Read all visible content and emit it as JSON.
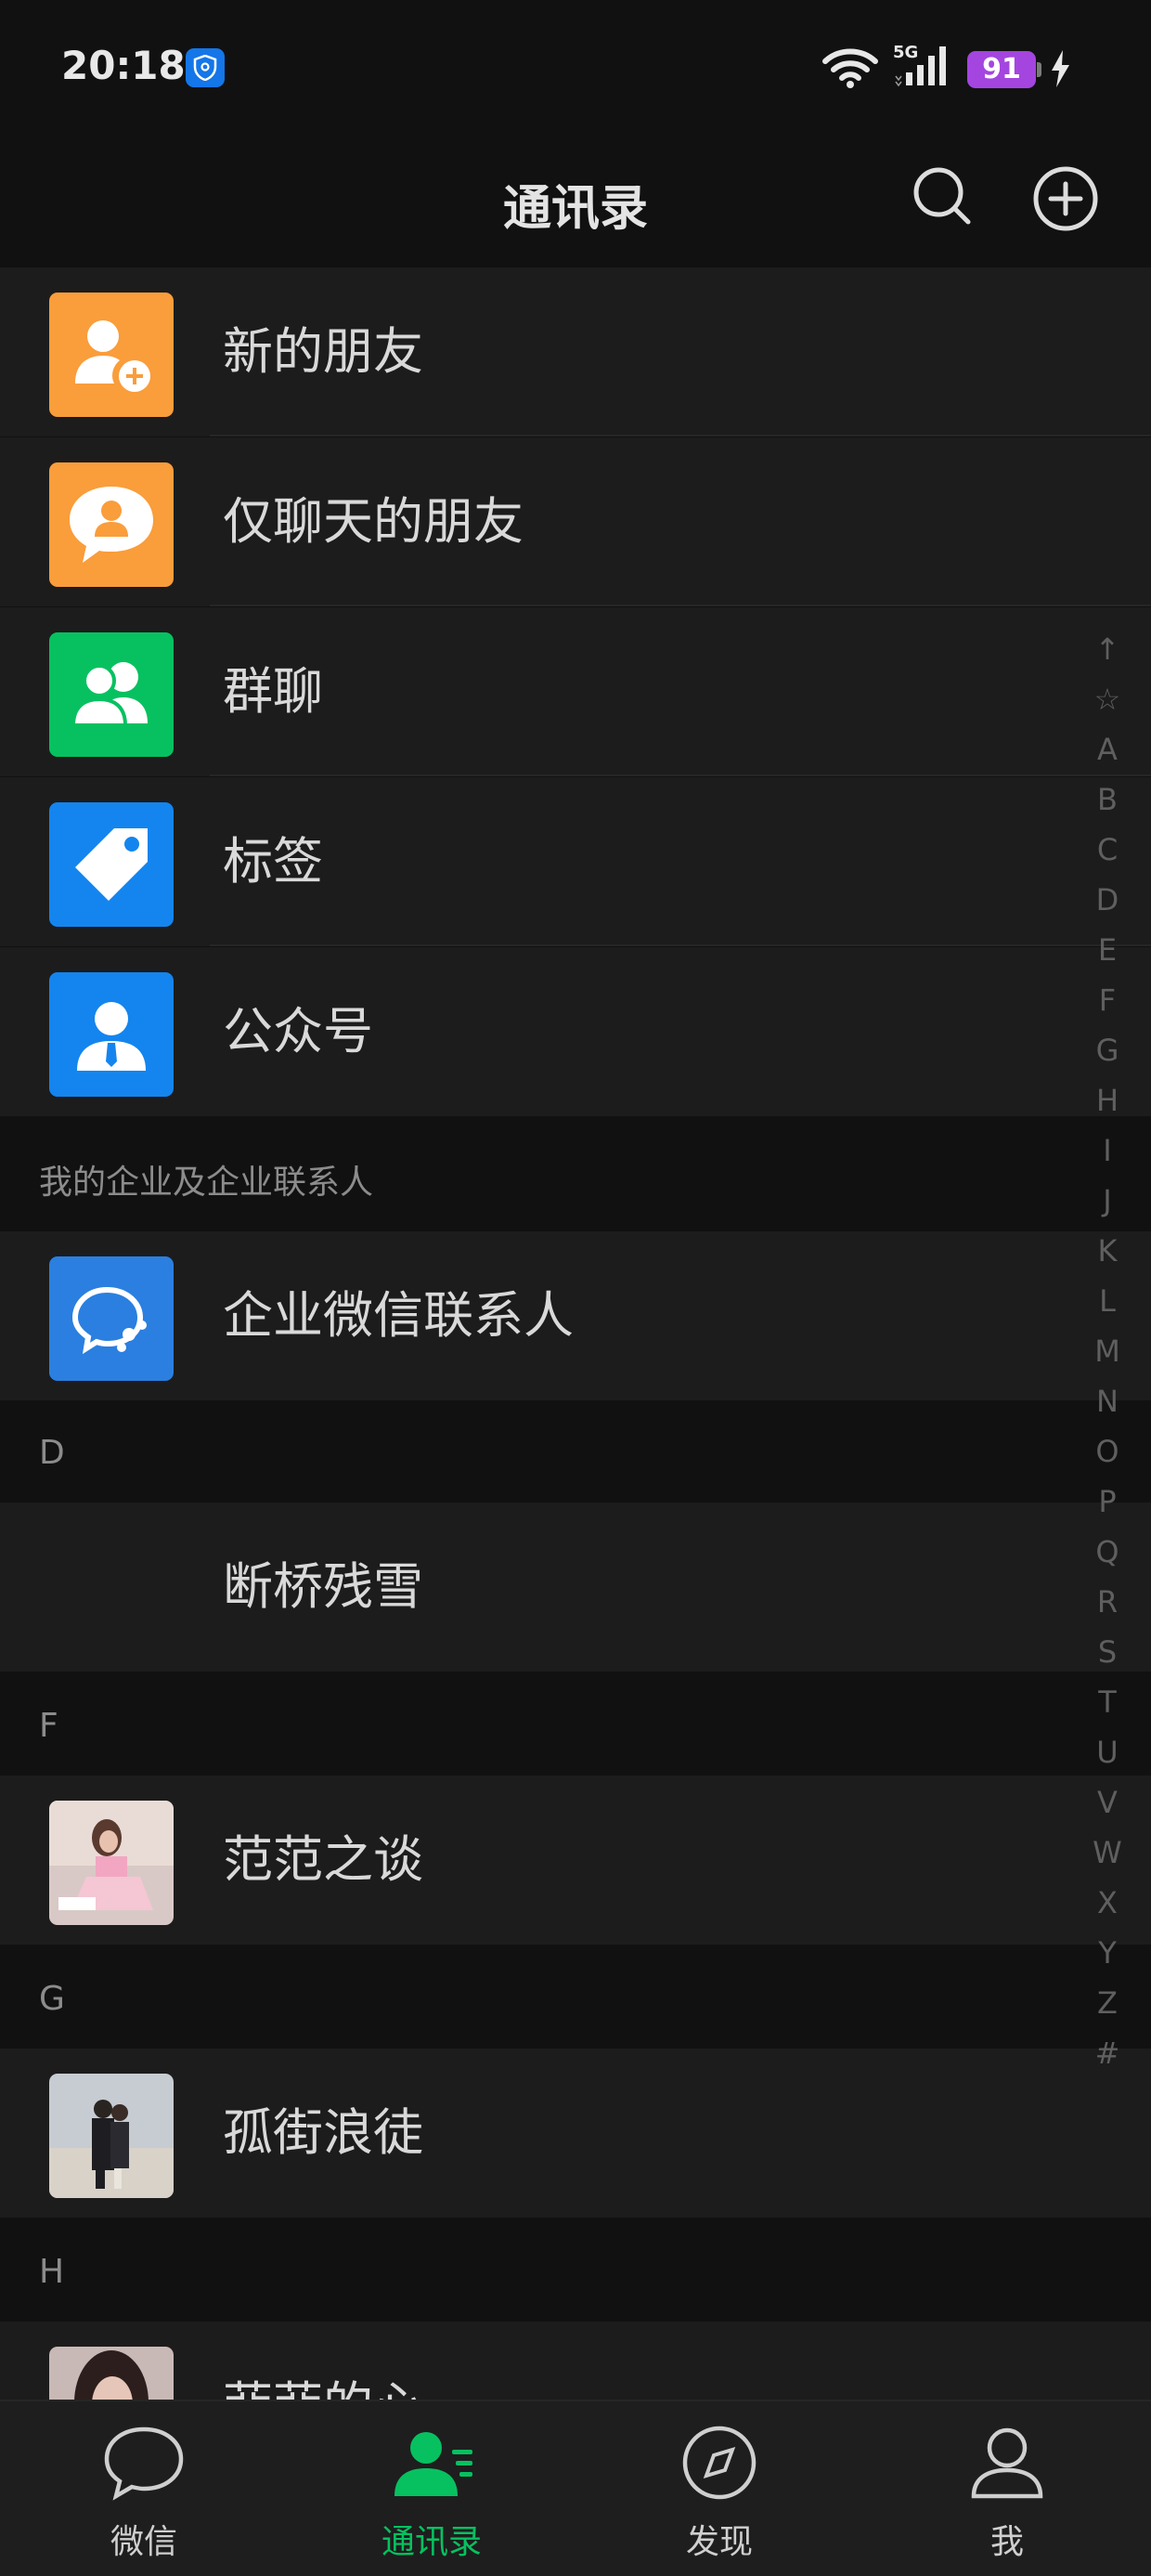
{
  "status_bar": {
    "time": "20:18",
    "network": "5G",
    "battery": "91"
  },
  "header": {
    "title": "通讯录"
  },
  "top_items": [
    {
      "label": "新的朋友",
      "icon": "add-friend-icon",
      "color": "#fa9d3b"
    },
    {
      "label": "仅聊天的朋友",
      "icon": "chat-only-friend-icon",
      "color": "#fa9d3b"
    },
    {
      "label": "群聊",
      "icon": "group-chat-icon",
      "color": "#07c160"
    },
    {
      "label": "标签",
      "icon": "tag-icon",
      "color": "#1485ee"
    },
    {
      "label": "公众号",
      "icon": "official-account-icon",
      "color": "#1485ee"
    }
  ],
  "enterprise": {
    "header": "我的企业及企业联系人",
    "item": "企业微信联系人"
  },
  "sections": [
    {
      "letter": "D",
      "contacts": [
        "断桥残雪"
      ]
    },
    {
      "letter": "F",
      "contacts": [
        "范范之谈"
      ]
    },
    {
      "letter": "G",
      "contacts": [
        "孤街浪徒"
      ]
    },
    {
      "letter": "H",
      "contacts": [
        "菲菲的心"
      ]
    }
  ],
  "alpha_index": [
    "↑",
    "☆",
    "A",
    "B",
    "C",
    "D",
    "E",
    "F",
    "G",
    "H",
    "I",
    "J",
    "K",
    "L",
    "M",
    "N",
    "O",
    "P",
    "Q",
    "R",
    "S",
    "T",
    "U",
    "V",
    "W",
    "X",
    "Y",
    "Z",
    "#"
  ],
  "tabs": [
    {
      "label": "微信",
      "icon": "chat-bubble-icon",
      "active": false
    },
    {
      "label": "通讯录",
      "icon": "contacts-icon",
      "active": true
    },
    {
      "label": "发现",
      "icon": "compass-icon",
      "active": false
    },
    {
      "label": "我",
      "icon": "person-icon",
      "active": false
    }
  ],
  "colors": {
    "accent": "#07c160",
    "background": "#111111",
    "row": "#1c1c1c"
  }
}
